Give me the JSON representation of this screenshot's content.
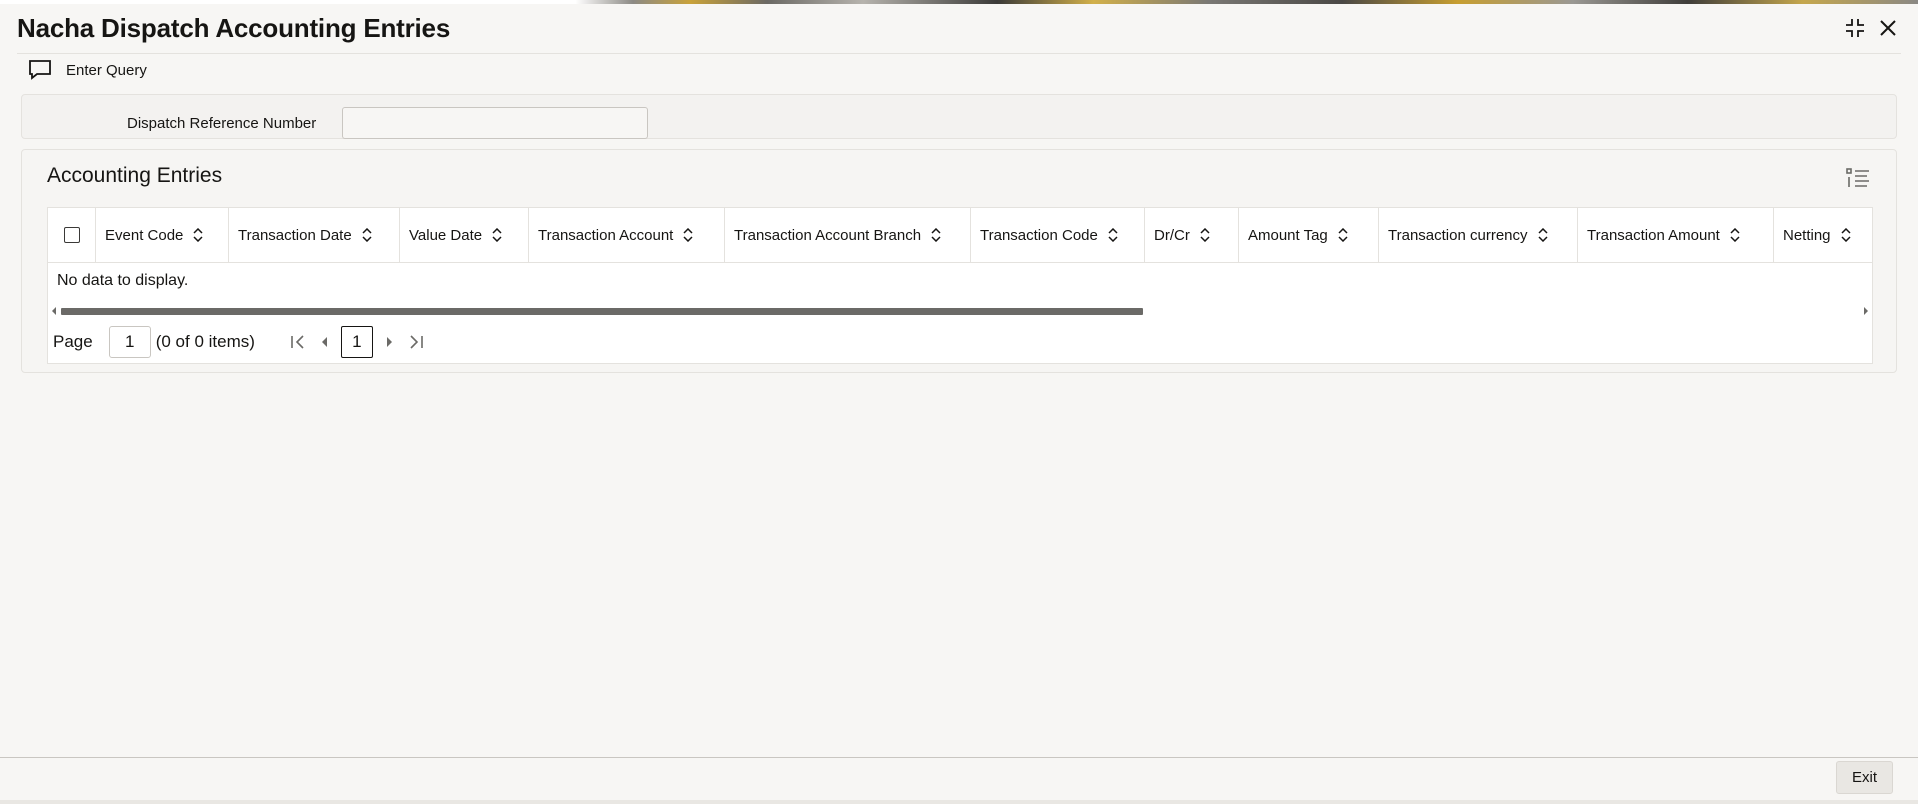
{
  "window": {
    "title": "Nacha Dispatch Accounting Entries"
  },
  "toolbar": {
    "enter_query_label": "Enter Query"
  },
  "criteria": {
    "dispatch_reference_label": "Dispatch Reference Number",
    "dispatch_reference_value": ""
  },
  "entries": {
    "section_title": "Accounting Entries",
    "columns": [
      "Event Code",
      "Transaction Date",
      "Value Date",
      "Transaction Account",
      "Transaction Account Branch",
      "Transaction Code",
      "Dr/Cr",
      "Amount Tag",
      "Transaction currency",
      "Transaction Amount",
      "Netting"
    ],
    "rows": [],
    "empty_message": "No data to display."
  },
  "pagination": {
    "page_label": "Page",
    "page_input": "1",
    "items_summary": "(0 of 0 items)",
    "current_page": "1"
  },
  "footer": {
    "exit_label": "Exit"
  },
  "icons": {
    "maximize": "maximize-icon",
    "close": "close-icon",
    "enter_query": "chat-bubble-icon",
    "column_settings": "list-settings-icon",
    "sort": "sort-up-down-icon"
  }
}
